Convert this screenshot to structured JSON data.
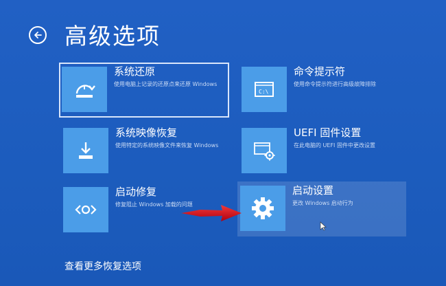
{
  "page": {
    "title": "高级选项",
    "more_options_link": "查看更多恢复选项"
  },
  "options": [
    {
      "title": "系统还原",
      "description": "使用电脑上记录的还原点来还原 Windows",
      "icon": "restore-icon"
    },
    {
      "title": "命令提示符",
      "description": "使用命令提示符进行高级故障排除",
      "icon": "command-prompt-icon"
    },
    {
      "title": "系统映像恢复",
      "description": "使用特定的系统映像文件来恢复 Windows",
      "icon": "system-image-icon"
    },
    {
      "title": "UEFI 固件设置",
      "description": "在此电脑的 UEFI 固件中更改设置",
      "icon": "uefi-firmware-icon"
    },
    {
      "title": "启动修复",
      "description": "修复阻止 Windows 加载的问题",
      "icon": "startup-repair-icon"
    },
    {
      "title": "启动设置",
      "description": "更改 Windows 启动行为",
      "icon": "gear-icon"
    }
  ],
  "colors": {
    "background": "#1d5fc0",
    "tile": "#4b9de8",
    "arrow": "#d8101c"
  }
}
